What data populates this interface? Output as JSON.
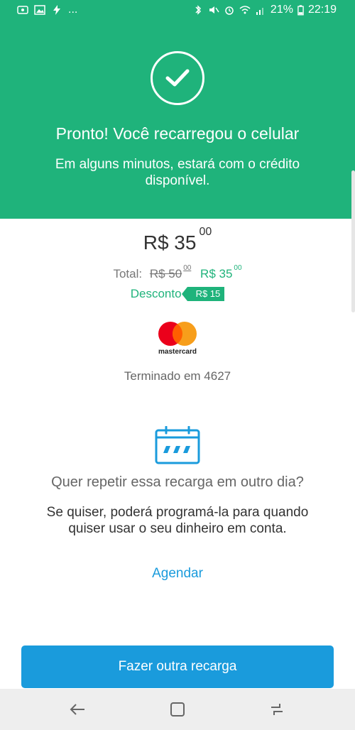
{
  "status_bar": {
    "left_icons": [
      "photos-icon",
      "image-icon",
      "flash-icon"
    ],
    "more": "...",
    "battery": "21%",
    "time": "22:19"
  },
  "header": {
    "title": "Pronto! Você recarregou o celular",
    "subtitle": "Em alguns minutos, estará com o crédito disponível."
  },
  "summary": {
    "amount_main": "R$ 35",
    "amount_cents": "00",
    "total_label": "Total:",
    "old_price": "R$ 50",
    "old_cents": "00",
    "new_price": "R$ 35",
    "new_cents": "00",
    "discount_label": "Desconto",
    "discount_value": "R$ 15"
  },
  "payment": {
    "brand": "mastercard",
    "card_ending": "Terminado em 4627"
  },
  "repeat": {
    "question": "Quer repetir essa recarga em outro dia?",
    "body": "Se quiser, poderá programá-la para quando quiser usar o seu dinheiro em conta.",
    "schedule_link": "Agendar"
  },
  "actions": {
    "primary": "Fazer outra recarga"
  },
  "colors": {
    "green": "#1fb37b",
    "blue": "#1a9bdc"
  }
}
